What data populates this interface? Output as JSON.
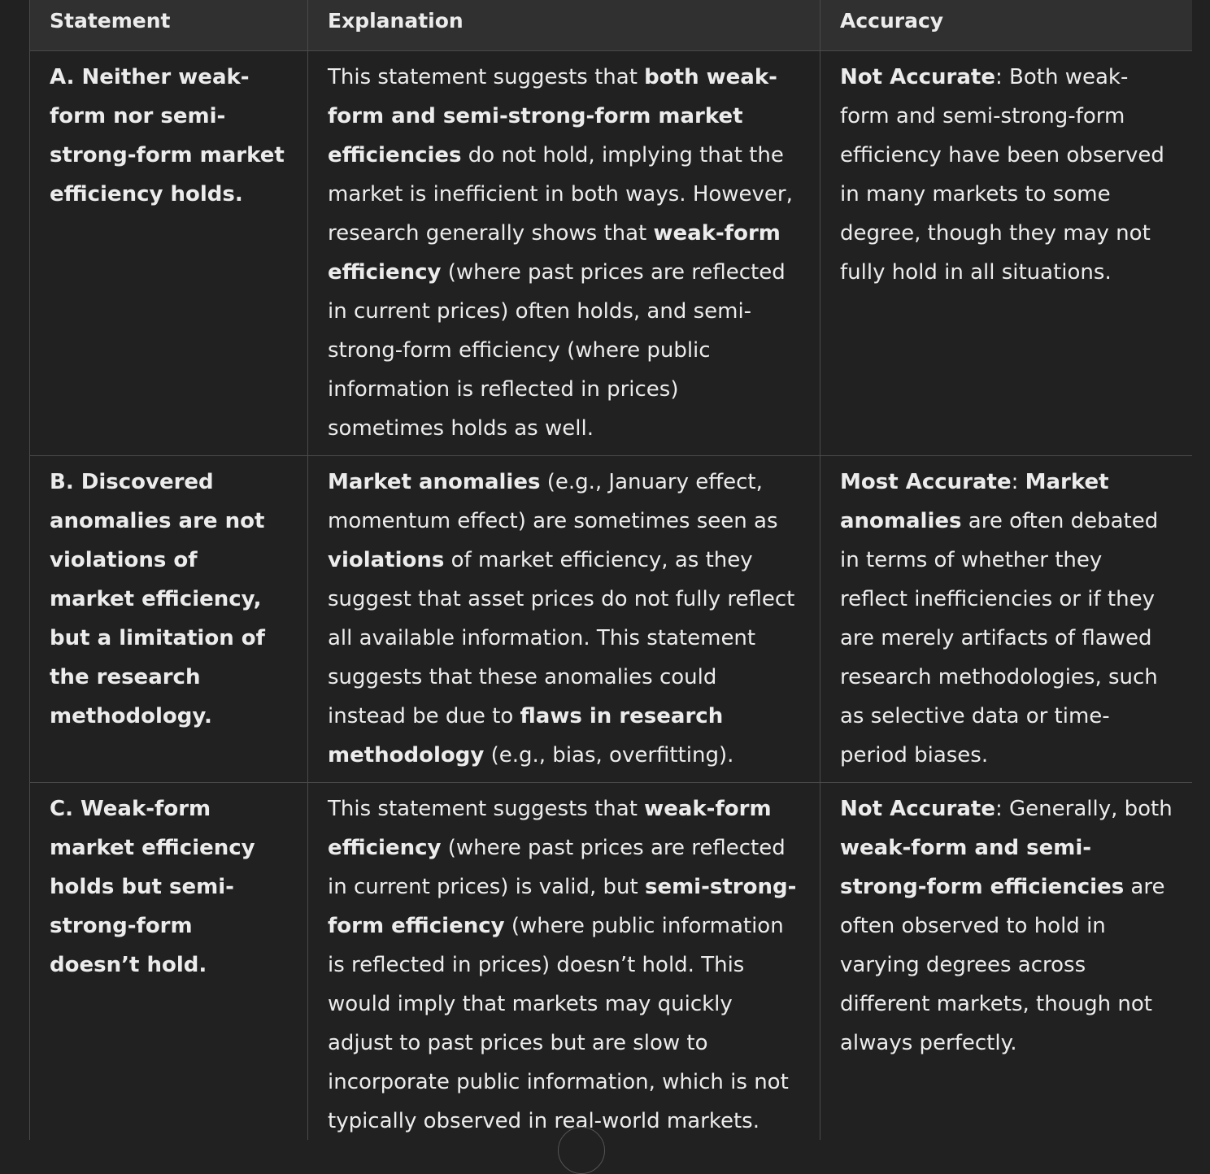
{
  "table": {
    "headers": [
      "Statement",
      "Explanation",
      "Accuracy"
    ],
    "rows": [
      {
        "statement": "A. Neither weak-form nor semi-strong-form market efficiency holds.",
        "explanation": [
          {
            "t": "This statement suggests that ",
            "b": false
          },
          {
            "t": "both weak-form and semi-strong-form market efficiencies",
            "b": true
          },
          {
            "t": " do not hold, implying that the market is inefficient in both ways. However, research generally shows that ",
            "b": false
          },
          {
            "t": "weak-form efficiency",
            "b": true
          },
          {
            "t": " (where past prices are reflected in current prices) often holds, and semi-strong-form efficiency (where public information is reflected in prices) sometimes holds as well.",
            "b": false
          }
        ],
        "accuracy": [
          {
            "t": "Not Accurate",
            "b": true
          },
          {
            "t": ": Both weak-form and semi-strong-form efficiency have been observed in many markets to some degree, though they may not fully hold in all situations.",
            "b": false
          }
        ]
      },
      {
        "statement": "B. Discovered anomalies are not violations of market efficiency, but a limitation of the research methodology.",
        "explanation": [
          {
            "t": "Market anomalies",
            "b": true
          },
          {
            "t": " (e.g., January effect, momentum effect) are sometimes seen as ",
            "b": false
          },
          {
            "t": "violations",
            "b": true
          },
          {
            "t": " of market efficiency, as they suggest that asset prices do not fully reflect all available information. This statement suggests that these anomalies could instead be due to ",
            "b": false
          },
          {
            "t": "flaws in research methodology",
            "b": true
          },
          {
            "t": " (e.g., bias, overfitting).",
            "b": false
          }
        ],
        "accuracy": [
          {
            "t": "Most Accurate",
            "b": true
          },
          {
            "t": ": ",
            "b": false
          },
          {
            "t": "Market anomalies",
            "b": true
          },
          {
            "t": " are often debated in terms of whether they reflect inefficiencies or if they are merely artifacts of flawed research methodologies, such as selective data or time-period biases.",
            "b": false
          }
        ]
      },
      {
        "statement": "C. Weak-form market efficiency holds but semi-strong-form doesn’t hold.",
        "explanation": [
          {
            "t": "This statement suggests that ",
            "b": false
          },
          {
            "t": "weak-form efficiency",
            "b": true
          },
          {
            "t": " (where past prices are reflected in current prices) is valid, but ",
            "b": false
          },
          {
            "t": "semi-strong-form efficiency",
            "b": true
          },
          {
            "t": " (where public information is reflected in prices) doesn’t hold. This would imply that markets may quickly adjust to past prices but are slow to incorporate public information, which is not typically observed in real-world markets.",
            "b": false
          }
        ],
        "accuracy": [
          {
            "t": "Not Accurate",
            "b": true
          },
          {
            "t": ": Generally, both ",
            "b": false
          },
          {
            "t": "weak-form and semi-strong-form efficiencies",
            "b": true
          },
          {
            "t": " are often observed to hold in varying degrees across different markets, though not always perfectly.",
            "b": false
          }
        ]
      }
    ]
  }
}
